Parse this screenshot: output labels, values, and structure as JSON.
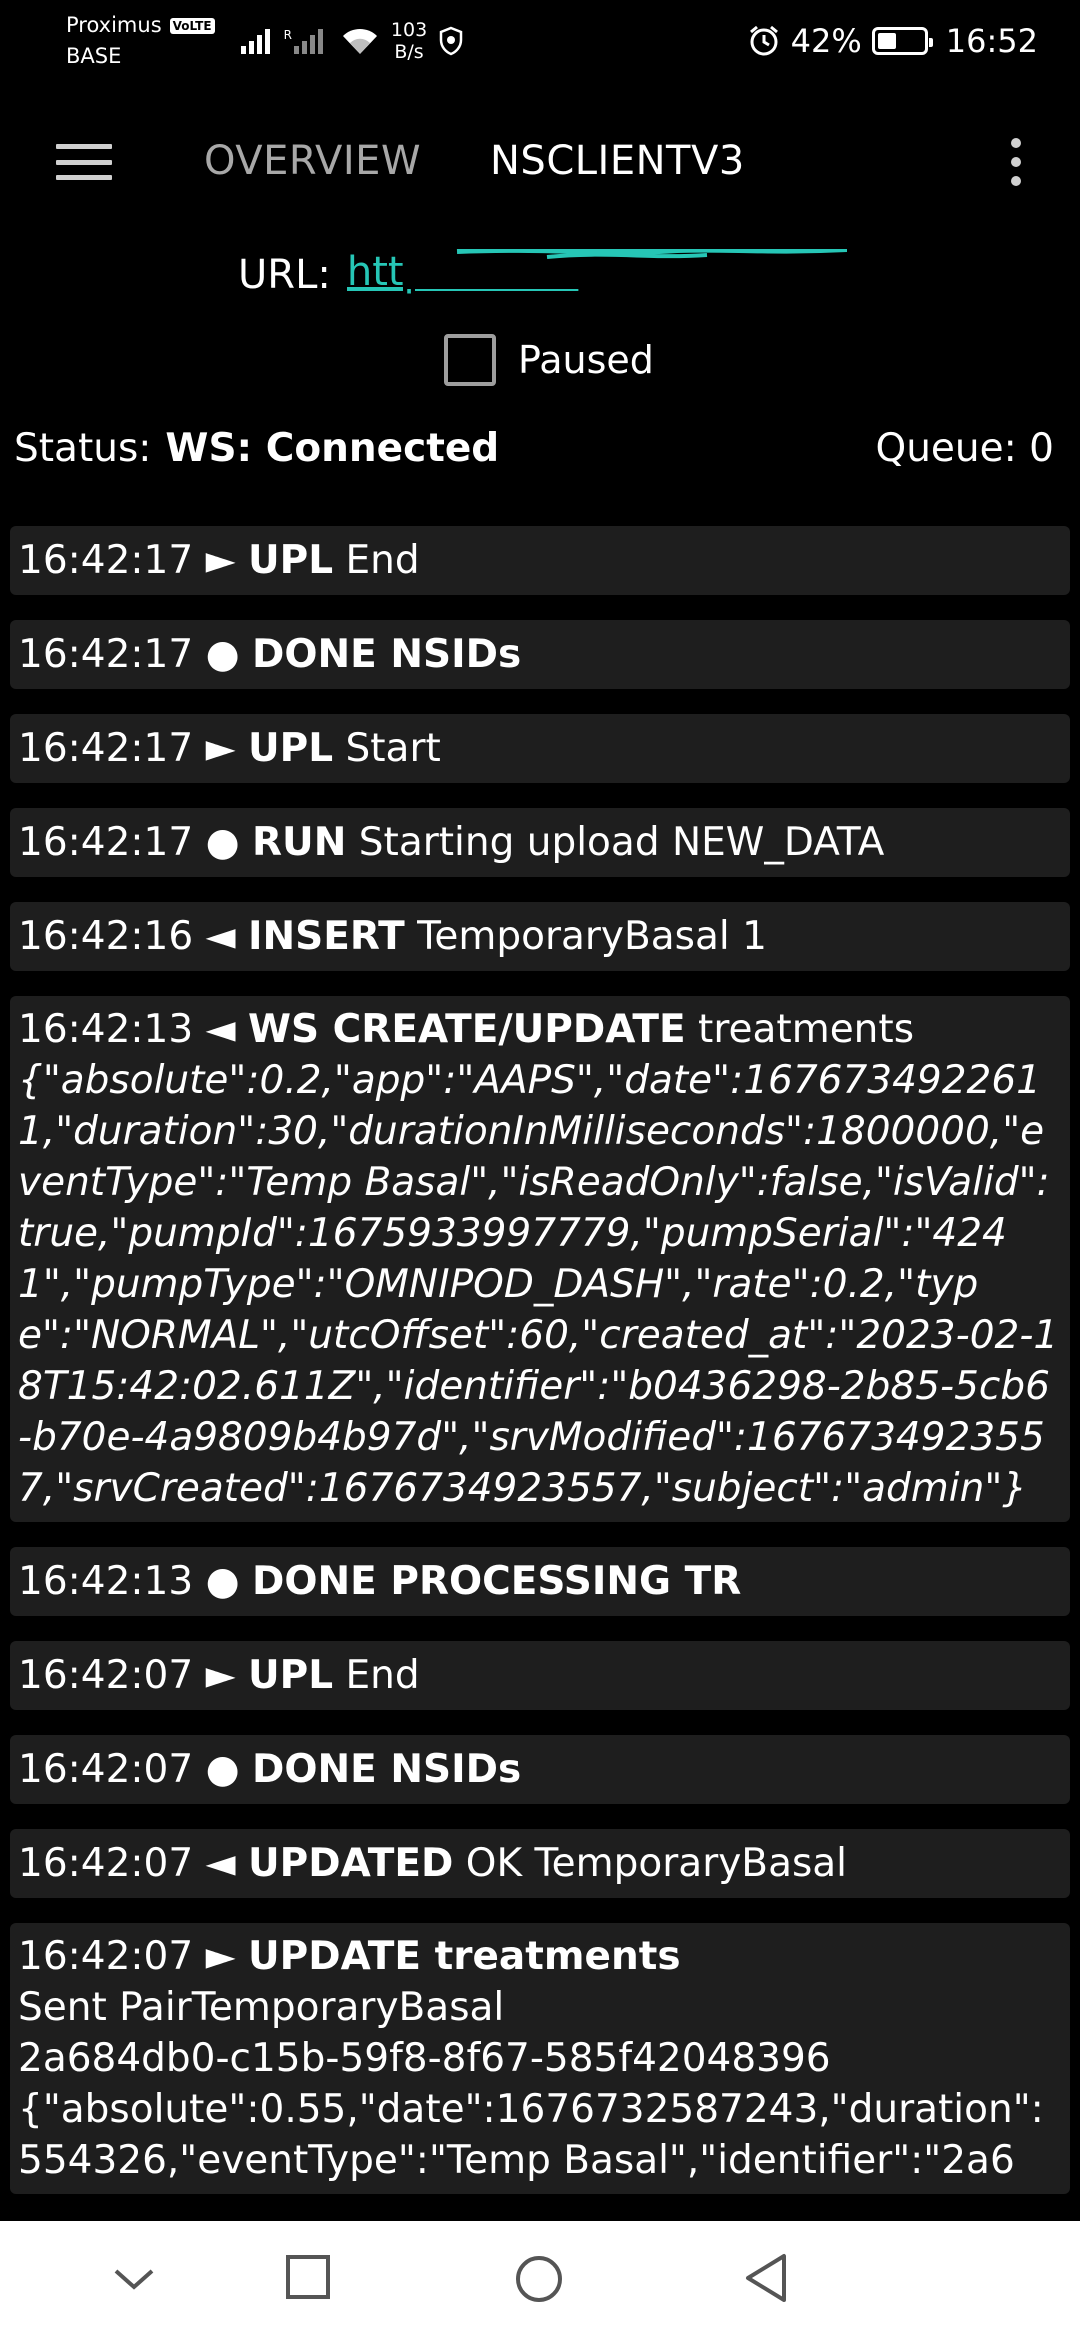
{
  "status_bar": {
    "carrier": "Proximus",
    "volte": "VoLTE",
    "carrier2": "BASE",
    "roaming_mark": "R",
    "net_speed_value": "103",
    "net_speed_unit": "B/s",
    "battery": "42%",
    "battery_level": 0.42,
    "time": "16:52"
  },
  "app_bar": {
    "tabs": [
      {
        "label": "OVERVIEW"
      },
      {
        "label": "NSCLIENTV3"
      }
    ]
  },
  "url": {
    "label": "URL:",
    "value": "https://...de"
  },
  "paused": {
    "label": "Paused",
    "checked": false
  },
  "status": {
    "label": "Status:",
    "value": "WS: Connected",
    "queue": "Queue: 0"
  },
  "log": [
    {
      "time": "16:42:17",
      "marker": "►",
      "action": "UPL",
      "text": "End"
    },
    {
      "time": "16:42:17",
      "marker": "●",
      "action": "DONE NSIDs",
      "text": ""
    },
    {
      "time": "16:42:17",
      "marker": "►",
      "action": "UPL",
      "text": "Start"
    },
    {
      "time": "16:42:17",
      "marker": "●",
      "action": "RUN",
      "text": "Starting upload NEW_DATA"
    },
    {
      "time": "16:42:16",
      "marker": "◄",
      "action": "INSERT",
      "text": "TemporaryBasal 1"
    },
    {
      "time": "16:42:13",
      "marker": "◄",
      "action": "WS CREATE/UPDATE",
      "text": "treatments",
      "json": "{\"absolute\":0.2,\"app\":\"AAPS\",\"date\":1676734922611,\"duration\":30,\"durationInMilliseconds\":1800000,\"eventType\":\"Temp Basal\",\"isReadOnly\":false,\"isValid\":true,\"pumpId\":1675933997779,\"pumpSerial\":\"4241\",\"pumpType\":\"OMNIPOD_DASH\",\"rate\":0.2,\"type\":\"NORMAL\",\"utcOffset\":60,\"created_at\":\"2023-02-18T15:42:02.611Z\",\"identifier\":\"b0436298-2b85-5cb6-b70e-4a9809b4b97d\",\"srvModified\":1676734923557,\"srvCreated\":1676734923557,\"subject\":\"admin\"}"
    },
    {
      "time": "16:42:13",
      "marker": "●",
      "action": "DONE PROCESSING TR",
      "text": ""
    },
    {
      "time": "16:42:07",
      "marker": "►",
      "action": "UPL",
      "text": "End"
    },
    {
      "time": "16:42:07",
      "marker": "●",
      "action": "DONE NSIDs",
      "text": ""
    },
    {
      "time": "16:42:07",
      "marker": "◄",
      "action": "UPDATED",
      "text": "OK TemporaryBasal"
    },
    {
      "time": "16:42:07",
      "marker": "►",
      "action": "UPDATE treatments",
      "text": "",
      "extra1": "Sent PairTemporaryBasal",
      "extra2": "2a684db0-c15b-59f8-8f67-585f42048396",
      "json2": "{\"absolute\":0.55,\"date\":1676732587243,\"duration\":554326,\"eventType\":\"Temp Basal\",\"identifier\":\"2a6"
    }
  ],
  "nav_bar": {
    "back": "back",
    "home": "home",
    "recents": "recents",
    "hide": "hide"
  }
}
